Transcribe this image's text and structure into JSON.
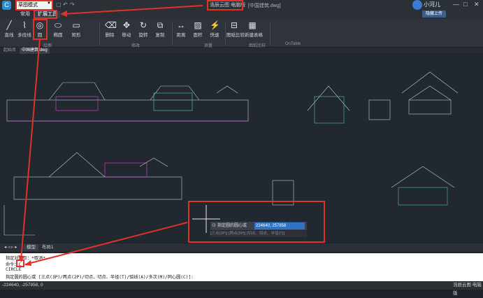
{
  "titlebar": {
    "mode_value": "草图模式",
    "cloud_label": "浩辰云图 电脑版",
    "doc_title": "[中国建筑.dwg]",
    "user_name": "小河儿",
    "upload_label": "隐藏上传",
    "controls": [
      "—",
      "□",
      "✕"
    ]
  },
  "tabs": {
    "common": "常用",
    "extension": "扩展工具"
  },
  "ribbon": {
    "buttons": [
      {
        "label": "直线",
        "icon": "line-icon",
        "glyph": "╱"
      },
      {
        "label": "多段线",
        "icon": "polyline-icon",
        "glyph": "⌇"
      },
      {
        "label": "圆",
        "icon": "circle-icon",
        "glyph": "◎"
      },
      {
        "label": "椭圆",
        "icon": "ellipse-icon",
        "glyph": "⬭"
      },
      {
        "label": "矩形",
        "icon": "rectangle-icon",
        "glyph": "▭"
      },
      {
        "label": "删除",
        "icon": "delete-icon",
        "glyph": "⌫"
      },
      {
        "label": "移动",
        "icon": "move-icon",
        "glyph": "✥"
      },
      {
        "label": "旋转",
        "icon": "rotate-icon",
        "glyph": "↻"
      },
      {
        "label": "复制",
        "icon": "copy-icon",
        "glyph": "⧉"
      },
      {
        "label": "距离",
        "icon": "distance-icon",
        "glyph": "↔"
      },
      {
        "label": "面积",
        "icon": "area-icon",
        "glyph": "▨"
      },
      {
        "label": "快速",
        "icon": "quick-icon",
        "glyph": "⚡"
      },
      {
        "label": "图纸比较",
        "icon": "compare-icon",
        "glyph": "⊟"
      },
      {
        "label": "新建表格",
        "icon": "table-icon",
        "glyph": "▦"
      }
    ],
    "groups": [
      "绘图",
      "修改",
      "测量",
      "图纸比较",
      "OnTable"
    ]
  },
  "doc_tabs": [
    "起始页",
    "中国建筑.dwg"
  ],
  "layout_tabs": [
    "模型",
    "布局1"
  ],
  "command_popup": {
    "prompt": "指定圆的圆心或",
    "value": "224640, 257858",
    "options": "[三点(3P)] [两点(2P)] [切点、切点、半径(T)]"
  },
  "command_lines": [
    "指定对角点：*取消*",
    "命令：C",
    "CIRCLE",
    "指定圆的圆心或 [三点(3P)/两点(2P)/切点、切点、半径(T)/弧线(A)/多次(M)/同心圆(C)]:"
  ],
  "status": {
    "coords": "-224640, -257858, 0",
    "right_label": "浩辰云图 电脑版"
  },
  "accent_color": "#e0322a"
}
